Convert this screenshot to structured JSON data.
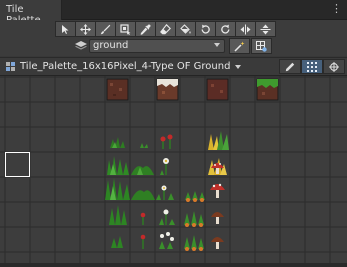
{
  "window": {
    "tab_title": "Tile Palette"
  },
  "toolbar": {
    "tools": [
      "select-tool",
      "move-tool",
      "paint-tool",
      "box-fill-tool",
      "picker-tool",
      "eraser-tool",
      "flood-fill-tool",
      "rotate-ccw-tool",
      "rotate-cw-tool",
      "flip-x-tool",
      "flip-y-tool"
    ]
  },
  "layer": {
    "selected": "ground"
  },
  "palette": {
    "selected": "Tile_Palette_16x16Pixel_4-Type OF Ground"
  },
  "colors": {
    "accent": "#46607c",
    "panel": "#3c3c3c",
    "grid_bg": "#3d3d3d",
    "grid_line": "#2c2c2c"
  }
}
